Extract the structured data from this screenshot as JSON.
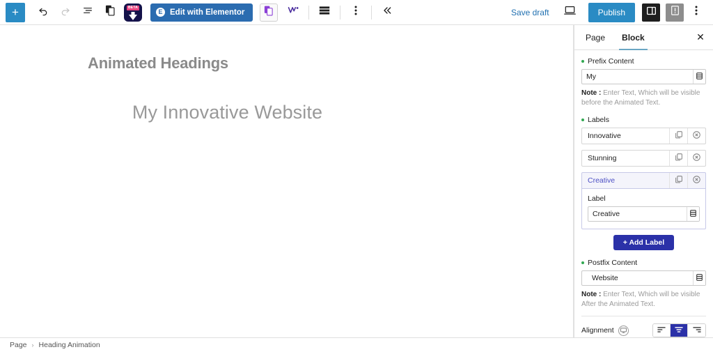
{
  "toolbar": {
    "add_label": "+",
    "undo_label": "undo",
    "redo_label": "redo",
    "list_view_label": "list-view",
    "copy_label": "copy",
    "beta_badge": "BETA",
    "elementor_button": "Edit with Elementor",
    "elementor_mark": "E",
    "save_draft": "Save draft",
    "publish": "Publish",
    "preview_label": "preview",
    "settings_label": "settings",
    "warning_label": "warning",
    "options_label": "options",
    "collapse_label": "collapse"
  },
  "canvas": {
    "doc_title": "Animated Headings",
    "animated_heading": "My Innovative Website"
  },
  "sidebar": {
    "tabs": [
      {
        "label": "Page",
        "active": false
      },
      {
        "label": "Block",
        "active": true
      }
    ],
    "close_label": "✕",
    "prefix": {
      "label": "Prefix Content",
      "value": "My",
      "placeholder": "",
      "note_prefix": "Note :",
      "note_text": " Enter Text, Which will be visible before the Animated Text."
    },
    "labels_section": {
      "label": "Labels",
      "items": [
        {
          "title": "Innovative",
          "selected": false
        },
        {
          "title": "Stunning",
          "selected": false
        },
        {
          "title": "Creative",
          "selected": true
        }
      ],
      "expanded_panel": {
        "field_label": "Label",
        "value": "Creative"
      },
      "add_button": "+ Add Label"
    },
    "postfix": {
      "label": "Postfix Content",
      "value": "Website",
      "placeholder": "",
      "note_prefix": "Note :",
      "note_text": " Enter Text, Which will be visible After the Animated Text."
    },
    "alignment": {
      "label": "Alignment",
      "options": [
        {
          "name": "align-left",
          "active": false
        },
        {
          "name": "align-center",
          "active": true
        },
        {
          "name": "align-right",
          "active": false
        }
      ]
    }
  },
  "footer": {
    "breadcrumbs": [
      "Page",
      "Heading Animation"
    ],
    "separator": "›"
  },
  "colors": {
    "accent_blue": "#2a8bc4",
    "elementor_blue": "#2b6cb0",
    "primary_indigo": "#2b31a8",
    "selected_lavender": "#f4f4fb",
    "selected_text": "#4c4fc4",
    "green_dot": "#32a852",
    "link_blue": "#2271b1"
  }
}
